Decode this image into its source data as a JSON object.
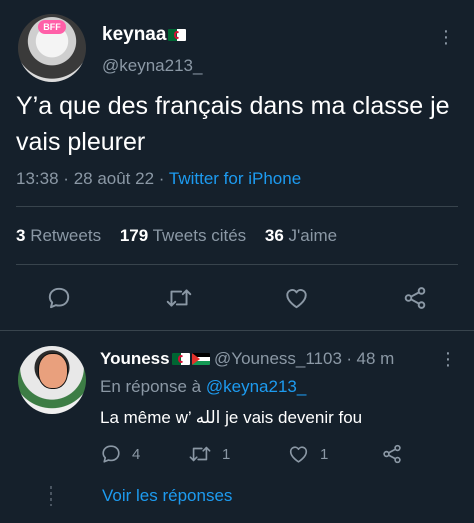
{
  "main_tweet": {
    "avatar_badge": "BFF",
    "display_name": "keynaa",
    "handle": "@keyna213_",
    "text": "Y’a que des français dans ma classe je vais pleurer",
    "time": "13:38",
    "date": "28 août 22",
    "source": "Twitter for iPhone",
    "stats": {
      "retweets_count": "3",
      "retweets_label": "Retweets",
      "quotes_count": "179",
      "quotes_label": "Tweets cités",
      "likes_count": "36",
      "likes_label": "J'aime"
    },
    "actions": [
      "reply-icon",
      "retweet-icon",
      "like-icon",
      "share-icon"
    ]
  },
  "reply": {
    "display_name": "Youness",
    "handle": "@Youness_1103",
    "age": "48 m",
    "reply_prefix": "En réponse à",
    "reply_to_handle": "@keyna213_",
    "text": "La même w’ الله je vais devenir fou",
    "reply_count": "4",
    "retweet_count": "1",
    "like_count": "1",
    "show_replies": "Voir les réponses"
  },
  "colors": {
    "background": "#15202b",
    "text_primary": "#ffffff",
    "text_secondary": "#8b98a5",
    "accent": "#1d9bf0",
    "divider": "#38444d"
  }
}
